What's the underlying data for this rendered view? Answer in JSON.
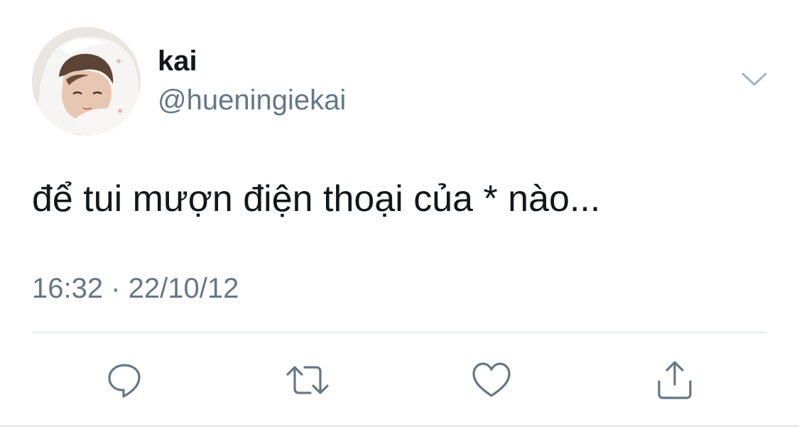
{
  "tweet": {
    "display_name": "kai",
    "handle": "@hueningiekai",
    "text": "để tui mượn điện thoại của * nào...",
    "timestamp": "16:32 · 22/10/12"
  },
  "icons": {
    "more": "chevron-down-icon",
    "reply": "reply-bubble-icon",
    "retweet": "retweet-icon",
    "like": "heart-icon",
    "share": "share-upload-icon"
  },
  "colors": {
    "text_primary": "#14171a",
    "text_secondary": "#657786",
    "icon": "#657786",
    "divider": "#d6dbdf"
  }
}
